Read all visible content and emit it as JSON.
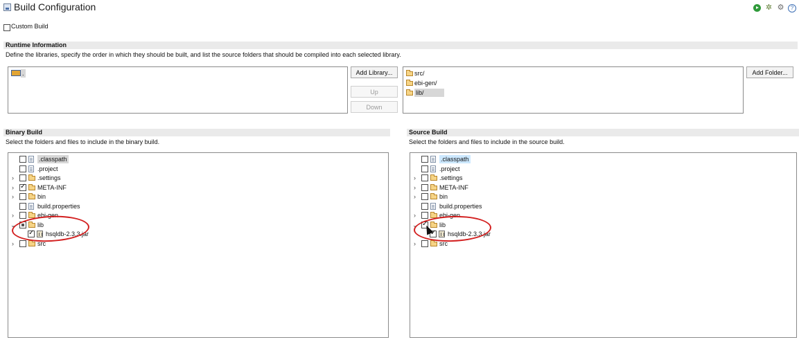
{
  "header": {
    "title": "Build Configuration",
    "toolbar": {
      "run_icon": "run-icon",
      "debug_icon": "debug-icon",
      "settings_icon": "settings-icon",
      "help_icon": "help-icon",
      "help_glyph": "?"
    }
  },
  "custom_build": {
    "label": "Custom Build",
    "checked": false
  },
  "runtime": {
    "heading": "Runtime Information",
    "description": "Define the libraries, specify the order in which they should be built, and list the source folders that should be compiled into each selected library.",
    "libraries": [
      {
        "label": ".",
        "selected": true
      }
    ],
    "buttons": {
      "add_library": "Add Library...",
      "up": "Up",
      "down": "Down",
      "add_folder": "Add Folder..."
    },
    "folders": [
      {
        "label": "src/",
        "selected": false
      },
      {
        "label": "ebi-gen/",
        "selected": false
      },
      {
        "label": "lib/",
        "selected": true
      }
    ]
  },
  "binary_build": {
    "heading": "Binary Build",
    "description": "Select the folders and files to include in the binary build.",
    "tree": [
      {
        "label": ".classpath",
        "type": "file",
        "checked": false,
        "expander": "",
        "selected": true
      },
      {
        "label": ".project",
        "type": "file",
        "checked": false,
        "expander": ""
      },
      {
        "label": ".settings",
        "type": "folder",
        "checked": false,
        "expander": ">"
      },
      {
        "label": "META-INF",
        "type": "folder",
        "checked": true,
        "expander": ">"
      },
      {
        "label": "bin",
        "type": "folder",
        "checked": false,
        "expander": ">"
      },
      {
        "label": "build.properties",
        "type": "file",
        "checked": false,
        "expander": ""
      },
      {
        "label": "ebi-gen",
        "type": "folder",
        "checked": false,
        "expander": ">"
      },
      {
        "label": "lib",
        "type": "folder",
        "checked": "partial",
        "expander": "v"
      },
      {
        "label": "hsqldb-2.3.3.jar",
        "type": "jar",
        "checked": true,
        "expander": "",
        "child": true
      },
      {
        "label": "src",
        "type": "folder",
        "checked": false,
        "expander": ">"
      }
    ]
  },
  "source_build": {
    "heading": "Source Build",
    "description": "Select the folders and files to include in the source build.",
    "tree": [
      {
        "label": ".classpath",
        "type": "file",
        "checked": false,
        "expander": "",
        "selected": true
      },
      {
        "label": ".project",
        "type": "file",
        "checked": false,
        "expander": ""
      },
      {
        "label": ".settings",
        "type": "folder",
        "checked": false,
        "expander": ">"
      },
      {
        "label": "META-INF",
        "type": "folder",
        "checked": false,
        "expander": ">"
      },
      {
        "label": "bin",
        "type": "folder",
        "checked": false,
        "expander": ">"
      },
      {
        "label": "build.properties",
        "type": "file",
        "checked": false,
        "expander": ""
      },
      {
        "label": "ebi-gen",
        "type": "folder",
        "checked": false,
        "expander": ">"
      },
      {
        "label": "lib",
        "type": "folder",
        "checked": true,
        "expander": "v"
      },
      {
        "label": "hsqldb-2.3.3.jar",
        "type": "jar",
        "checked": true,
        "expander": "",
        "child": true
      },
      {
        "label": "src",
        "type": "folder",
        "checked": false,
        "expander": ">"
      }
    ]
  },
  "colors": {
    "highlight_ring": "#d32020",
    "section_bar": "#eaeaea",
    "selection_blue": "#cce8ff"
  }
}
